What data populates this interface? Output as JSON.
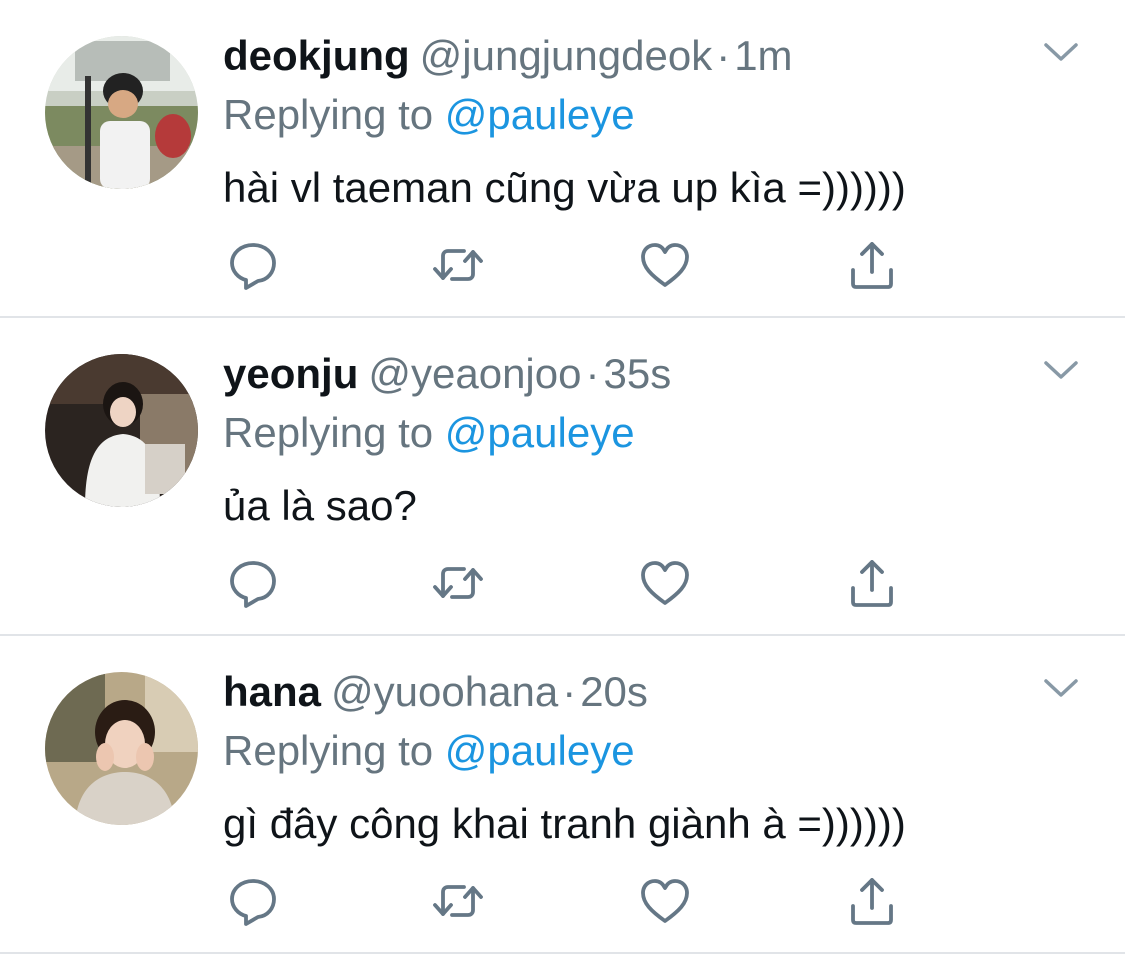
{
  "tweets": [
    {
      "name": "deokjung",
      "handle": "@jungjungdeok",
      "dot": "·",
      "time": "1m",
      "replying_prefix": "Replying to",
      "replying_to": "@pauleye",
      "text": "hài vl taeman cũng vừa up kìa =))))))",
      "avatar": "avatar-photo"
    },
    {
      "name": "yeonju",
      "handle": "@yeaonjoo",
      "dot": "·",
      "time": "35s",
      "replying_prefix": "Replying to",
      "replying_to": "@pauleye",
      "text": "ủa là sao?",
      "avatar": "avatar-photo"
    },
    {
      "name": "hana",
      "handle": "@yuoohana",
      "dot": "·",
      "time": "20s",
      "replying_prefix": "Replying to",
      "replying_to": "@pauleye",
      "text": "gì đây công khai tranh giành à =))))))",
      "avatar": "avatar-photo"
    }
  ],
  "icons": {
    "reply": "reply-icon",
    "retweet": "retweet-icon",
    "like": "heart-icon",
    "share": "share-icon",
    "caret": "chevron-down-icon"
  },
  "colors": {
    "text": "#0f1419",
    "secondary": "#66757f",
    "link": "#1b95e0",
    "icon": "#657786",
    "divider": "#e1e4e8"
  }
}
